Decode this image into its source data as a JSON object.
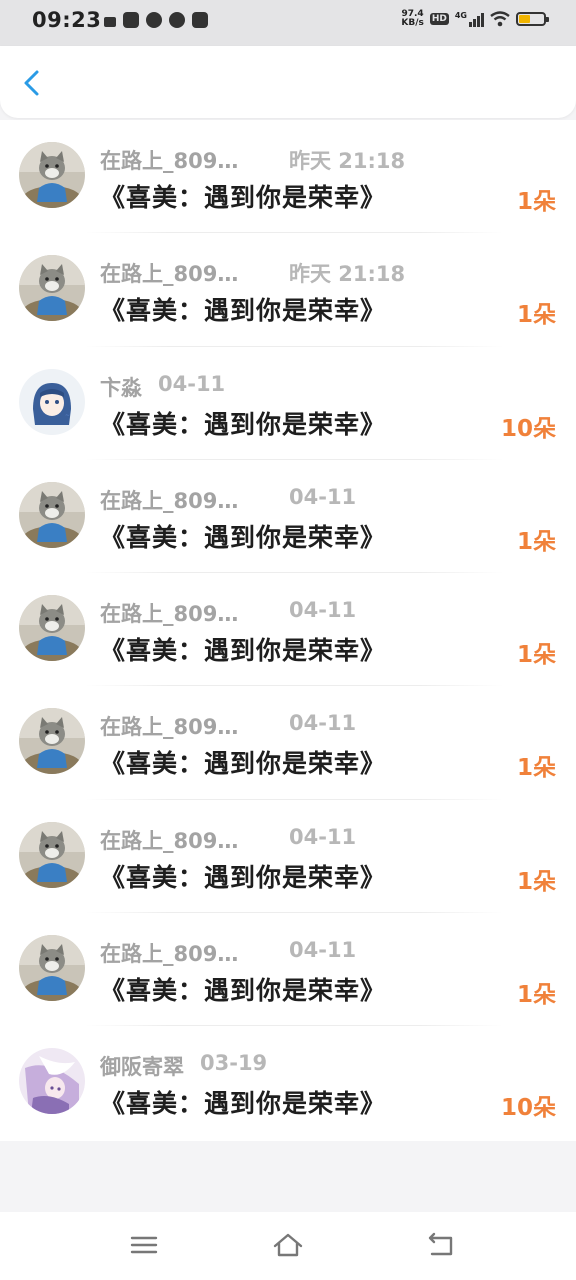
{
  "status_bar": {
    "time": "09:23",
    "net_speed_value": "97.4",
    "net_speed_unit": "KB/s",
    "hd": "HD",
    "network": "4G",
    "battery_level": 0.45,
    "battery_color": "#f0b400"
  },
  "header": {
    "back_icon": "chevron-left-icon",
    "accent": "#2a9be6"
  },
  "gifts": [
    {
      "name": "在路上_809…",
      "time": "昨天 21:18",
      "title": "《喜美：遇到你是荣幸》",
      "count": "1朵",
      "avatar": "cat"
    },
    {
      "name": "在路上_809…",
      "time": "昨天 21:18",
      "title": "《喜美：遇到你是荣幸》",
      "count": "1朵",
      "avatar": "cat"
    },
    {
      "name": "卞淼",
      "time": "04-11",
      "title": "《喜美：遇到你是荣幸》",
      "count": "10朵",
      "avatar": "anime-blue"
    },
    {
      "name": "在路上_809…",
      "time": "04-11",
      "title": "《喜美：遇到你是荣幸》",
      "count": "1朵",
      "avatar": "cat"
    },
    {
      "name": "在路上_809…",
      "time": "04-11",
      "title": "《喜美：遇到你是荣幸》",
      "count": "1朵",
      "avatar": "cat"
    },
    {
      "name": "在路上_809…",
      "time": "04-11",
      "title": "《喜美：遇到你是荣幸》",
      "count": "1朵",
      "avatar": "cat"
    },
    {
      "name": "在路上_809…",
      "time": "04-11",
      "title": "《喜美：遇到你是荣幸》",
      "count": "1朵",
      "avatar": "cat"
    },
    {
      "name": "在路上_809…",
      "time": "04-11",
      "title": "《喜美：遇到你是荣幸》",
      "count": "1朵",
      "avatar": "cat"
    },
    {
      "name": "御阪寄翠",
      "time": "03-19",
      "title": "《喜美：遇到你是荣幸》",
      "count": "10朵",
      "avatar": "anime-purple"
    }
  ],
  "count_color": "#f0813a",
  "nav": {
    "menu_icon": "menu-icon",
    "home_icon": "home-icon",
    "back_icon": "back-arrow-icon"
  }
}
